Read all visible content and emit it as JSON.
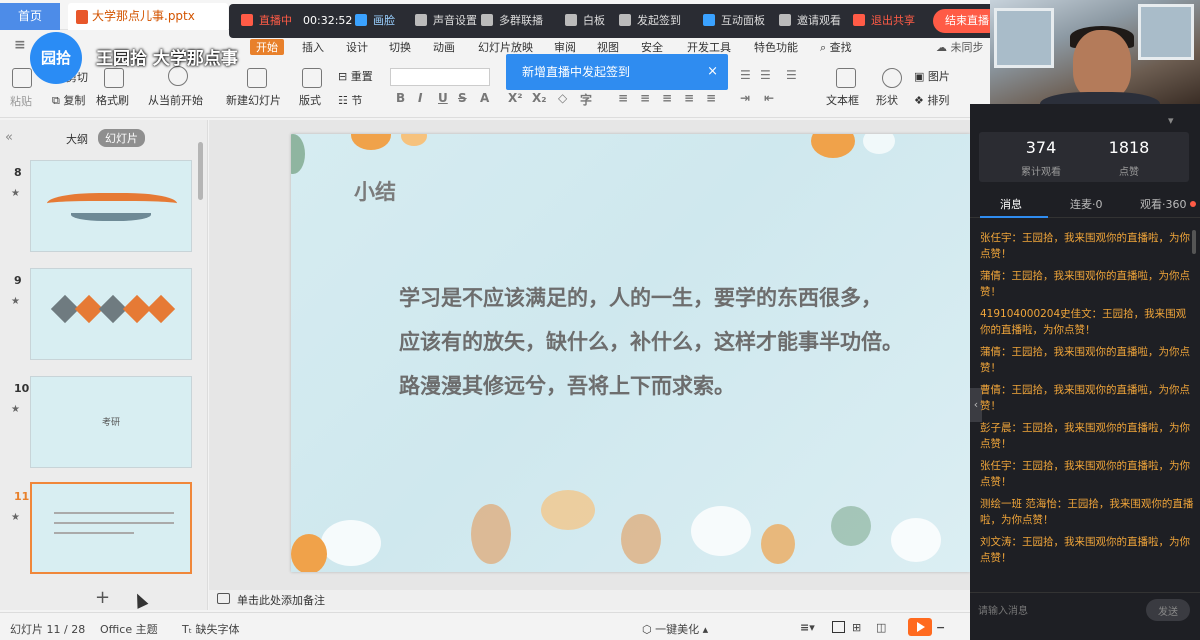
{
  "tabs": {
    "home": "首页",
    "file": "大学那点儿事.pptx"
  },
  "live_toolbar": {
    "status": "直播中",
    "timer": "00:32:52",
    "items": [
      "画脸",
      "声音设置",
      "多群联播",
      "白板",
      "发起签到",
      "互动面板",
      "邀请观看"
    ],
    "exit_share": "退出共享",
    "end_live": "结束直播"
  },
  "logo": {
    "badge": "园拾",
    "name": "王园拾 大学那点事"
  },
  "menu": {
    "active": "开始",
    "items": [
      "插入",
      "设计",
      "切换",
      "动画",
      "幻灯片放映",
      "审阅",
      "视图",
      "安全",
      "开发工具",
      "特色功能"
    ],
    "search": "查找",
    "sync": "未同步"
  },
  "ribbon": {
    "cut": "剪切",
    "paste": "粘贴",
    "copy": "复制",
    "format_painter": "格式刷",
    "from_current": "从当前开始",
    "new_slide": "新建幻灯片",
    "layout": "版式",
    "reset": "重置",
    "section": "节",
    "textbox": "文本框",
    "shape": "形状",
    "picture": "图片",
    "arrange": "排列"
  },
  "toast": {
    "message": "新增直播中发起签到",
    "close": "×"
  },
  "thumbs": {
    "outline_label": "大纲",
    "slides_label": "幻灯片",
    "items": [
      {
        "num": "8"
      },
      {
        "num": "9"
      },
      {
        "num": "10",
        "title": "考研"
      },
      {
        "num": "11"
      }
    ]
  },
  "slide": {
    "title": "小结",
    "lines": [
      "学习是不应该满足的，人的一生，要学的东西很多，",
      "应该有的放矢，缺什么，补什么，这样才能事半功倍。",
      "路漫漫其修远兮，吾将上下而求索。"
    ]
  },
  "notes": {
    "placeholder": "单击此处添加备注"
  },
  "statusbar": {
    "slide_count": "幻灯片 11 / 28",
    "theme": "Office 主题",
    "missing_font": "缺失字体",
    "beautify": "一键美化"
  },
  "live_panel": {
    "viewers_total": "374",
    "viewers_label": "累计观看",
    "likes": "1818",
    "likes_label": "点赞",
    "tab_messages": "消息",
    "tab_mic": "连麦·0",
    "tab_watch": "观看·360",
    "messages": [
      "张任宇：王园拾，我来围观你的直播啦，为你点赞！",
      "蒲倩：王园拾，我来围观你的直播啦，为你点赞！",
      "419104000204史佳文：王园拾，我来围观你的直播啦，为你点赞！",
      "蒲倩：王园拾，我来围观你的直播啦，为你点赞！",
      "曹倩：王园拾，我来围观你的直播啦，为你点赞！",
      "彭子晨：王园拾，我来围观你的直播啦，为你点赞！",
      "张任宇：王园拾，我来围观你的直播啦，为你点赞！",
      "测绘一班 范海怡：王园拾，我来围观你的直播啦，为你点赞！",
      "刘文涛：王园拾，我来围观你的直播啦，为你点赞！"
    ],
    "input_placeholder": "请输入消息",
    "send": "发送"
  }
}
